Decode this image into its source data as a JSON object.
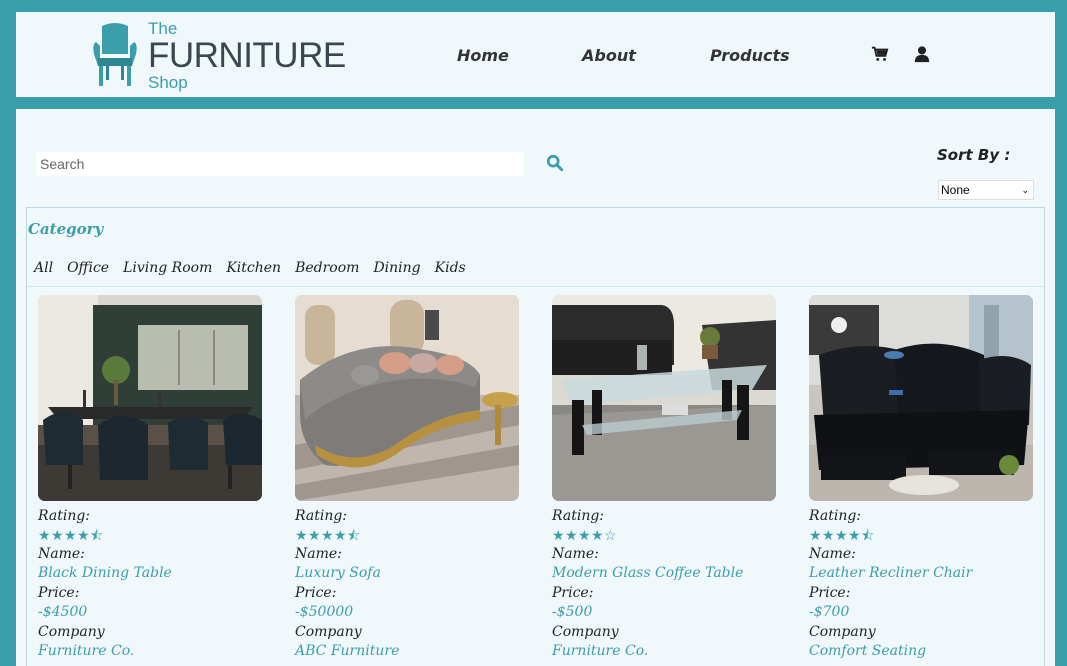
{
  "header": {
    "logo": {
      "line1": "The",
      "line2": "FURNITURE",
      "line3": "Shop"
    },
    "nav": [
      {
        "label": "Home"
      },
      {
        "label": "About"
      },
      {
        "label": "Products"
      }
    ],
    "icons": [
      "cart-icon",
      "user-icon"
    ]
  },
  "toolbar": {
    "search_placeholder": "Search",
    "sort_label": "Sort By :",
    "sort_selected": "None"
  },
  "category": {
    "title": "Category",
    "items": [
      "All",
      "Office",
      "Living Room",
      "Kitchen",
      "Bedroom",
      "Dining",
      "Kids"
    ]
  },
  "labels": {
    "rating": "Rating:",
    "name": "Name:",
    "price": "Price:",
    "company": "Company"
  },
  "products": [
    {
      "name": "Black Dining Table",
      "price": "-$4500",
      "company": "Furniture Co.",
      "rating": 4.5
    },
    {
      "name": "Luxury Sofa",
      "price": "-$50000",
      "company": "ABC Furniture",
      "rating": 4.5
    },
    {
      "name": "Modern Glass Coffee Table",
      "price": "-$500",
      "company": "Furniture Co.",
      "rating": 4
    },
    {
      "name": "Leather Recliner Chair",
      "price": "-$700",
      "company": "Comfort Seating",
      "rating": 4.5
    }
  ],
  "colors": {
    "accent": "#3a9eab",
    "panel": "#f0f8fc",
    "text": "#222222"
  }
}
